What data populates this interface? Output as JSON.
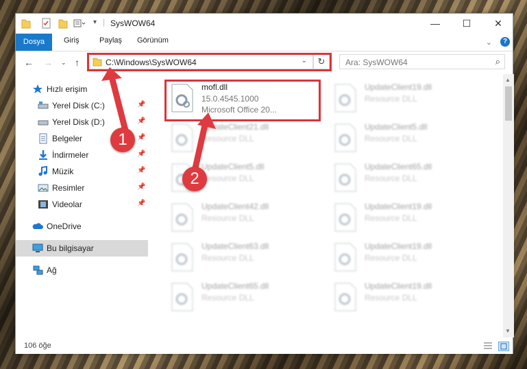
{
  "window": {
    "title": "SysWOW64",
    "minimize": "—",
    "maximize": "☐",
    "close": "✕"
  },
  "ribbon": {
    "tabs": [
      "Dosya",
      "Giriş",
      "Paylaş",
      "Görünüm"
    ],
    "help": "?"
  },
  "navigation": {
    "address": "C:\\Windows\\SysWOW64",
    "search_placeholder": "Ara: SysWOW64"
  },
  "sidebar": {
    "items": [
      {
        "label": "Hızlı erişim",
        "icon": "star-icon",
        "pinned": false
      },
      {
        "label": "Yerel Disk (C:)",
        "icon": "drive-icon",
        "pinned": true
      },
      {
        "label": "Yerel Disk (D:)",
        "icon": "drive-icon",
        "pinned": true
      },
      {
        "label": "Belgeler",
        "icon": "documents-icon",
        "pinned": true
      },
      {
        "label": "İndirmeler",
        "icon": "downloads-icon",
        "pinned": true
      },
      {
        "label": "Müzik",
        "icon": "music-icon",
        "pinned": true
      },
      {
        "label": "Resimler",
        "icon": "pictures-icon",
        "pinned": true
      },
      {
        "label": "Videolar",
        "icon": "videos-icon",
        "pinned": true
      },
      {
        "label": "OneDrive",
        "icon": "cloud-icon",
        "pinned": false
      },
      {
        "label": "Bu bilgisayar",
        "icon": "computer-icon",
        "pinned": false,
        "selected": true
      },
      {
        "label": "Ağ",
        "icon": "network-icon",
        "pinned": false
      }
    ]
  },
  "files": [
    {
      "name": "mofl.dll",
      "version": "15.0.4545.1000",
      "company": "Microsoft Office 20...",
      "highlighted": true
    },
    {
      "name": "UpdateClient19.dll",
      "type": "Resource DLL"
    },
    {
      "name": "UpdateClient21.dll",
      "type": "Resource DLL"
    },
    {
      "name": "UpdateClient5.dll",
      "type": "Resource DLL"
    },
    {
      "name": "UpdateClient5.dll",
      "type": "Resource DLL"
    },
    {
      "name": "UpdateClient65.dll",
      "type": "Resource DLL"
    },
    {
      "name": "UpdateClient42.dll",
      "type": "Resource DLL"
    },
    {
      "name": "UpdateClient19.dll",
      "type": "Resource DLL"
    },
    {
      "name": "UpdateClient63.dll",
      "type": "Resource DLL"
    },
    {
      "name": "UpdateClient19.dll",
      "type": "Resource DLL"
    },
    {
      "name": "UpdateClient65.dll",
      "type": "Resource DLL"
    },
    {
      "name": "UpdateClient19.dll",
      "type": "Resource DLL"
    }
  ],
  "status": {
    "count": "106 öğe"
  },
  "annotations": {
    "step1": "1",
    "step2": "2",
    "color": "#df3a3f"
  },
  "colors": {
    "accent": "#1979ca",
    "selection": "#d9d9d9",
    "highlight": "#d9343b"
  }
}
